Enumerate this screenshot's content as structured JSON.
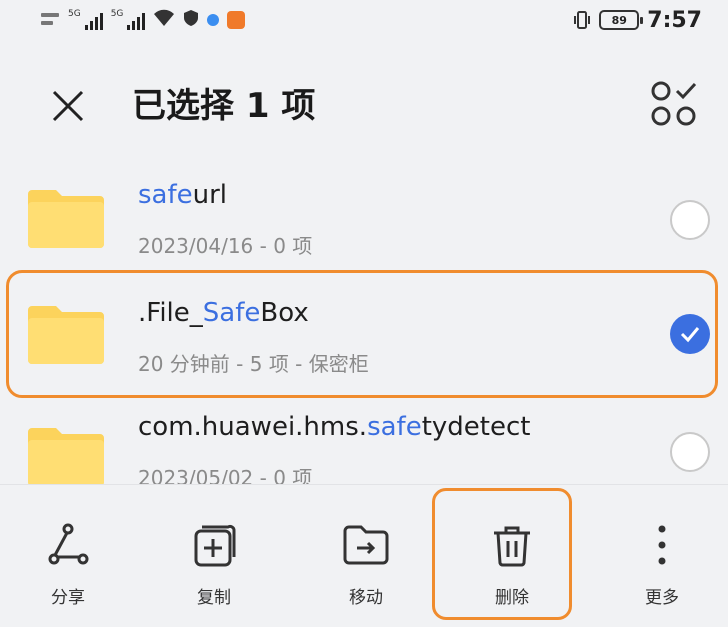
{
  "status_bar": {
    "sim1_label": "5G",
    "sim2_label": "5G",
    "battery": "89",
    "time": "7:57"
  },
  "header": {
    "title": "已选择 1 项",
    "close_icon": "close-icon",
    "select_all_icon": "select-all-icon"
  },
  "files": [
    {
      "name_prefix": "",
      "name_highlight": "safe",
      "name_suffix": "url",
      "meta": "2023/04/16 - 0 项",
      "selected": false
    },
    {
      "name_prefix": ".File_",
      "name_highlight": "Safe",
      "name_suffix": "Box",
      "meta": "20 分钟前 - 5 项 - 保密柜",
      "selected": true
    },
    {
      "name_prefix": "com.huawei.hms.",
      "name_highlight": "safe",
      "name_suffix": "tydetect",
      "meta": "2023/05/02 - 0 项",
      "selected": false
    }
  ],
  "actions": [
    {
      "label": "分享",
      "icon": "share-icon"
    },
    {
      "label": "复制",
      "icon": "copy-icon"
    },
    {
      "label": "移动",
      "icon": "move-icon"
    },
    {
      "label": "删除",
      "icon": "trash-icon"
    },
    {
      "label": "更多",
      "icon": "more-icon"
    }
  ],
  "colors": {
    "accent": "#3b6fe0",
    "highlight_frame": "#f08c2e",
    "folder": "#fcd35c",
    "background": "#f1f2f4"
  }
}
